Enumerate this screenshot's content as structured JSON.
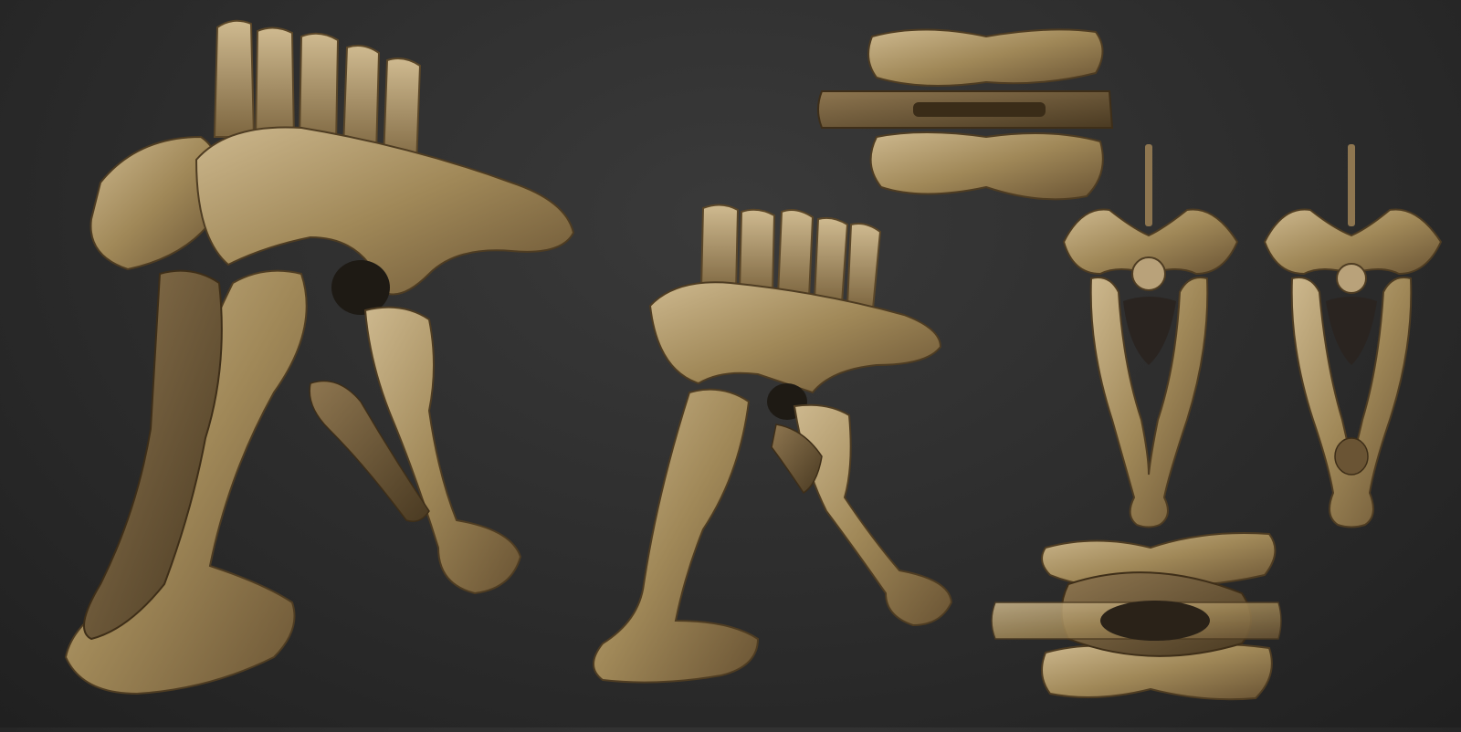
{
  "scene": {
    "background_color": "#2e2e2e",
    "bone_colors": {
      "light": "#c9b48a",
      "mid": "#9c8458",
      "dark": "#5e4a2c",
      "shadow": "#2a2218"
    },
    "views": [
      {
        "name": "pelvis-three-quarter-large",
        "icon": "bone-render"
      },
      {
        "name": "pelvis-side",
        "icon": "bone-render"
      },
      {
        "name": "pelvis-top",
        "icon": "bone-render"
      },
      {
        "name": "pelvis-front",
        "icon": "bone-render"
      },
      {
        "name": "pelvis-back",
        "icon": "bone-render"
      },
      {
        "name": "pelvis-bottom",
        "icon": "bone-render"
      }
    ]
  }
}
